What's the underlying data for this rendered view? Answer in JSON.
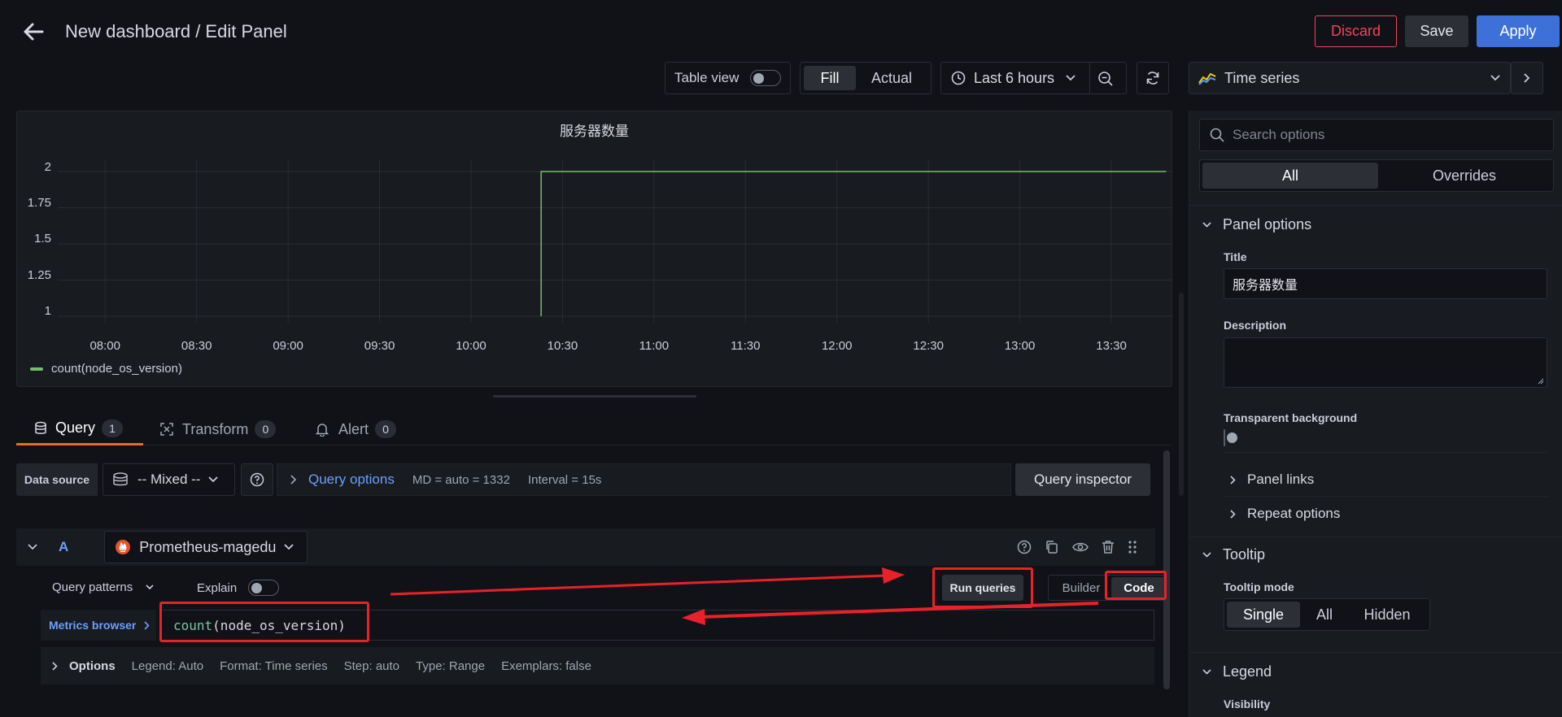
{
  "header": {
    "title": "New dashboard / Edit Panel",
    "discard_label": "Discard",
    "save_label": "Save",
    "apply_label": "Apply"
  },
  "toolbar": {
    "table_view_label": "Table view",
    "fill_label": "Fill",
    "actual_label": "Actual",
    "time_range_label": "Last 6 hours"
  },
  "viz_picker": {
    "label": "Time series"
  },
  "chart_data": {
    "type": "line",
    "title": "服务器数量",
    "x": [
      "10:23",
      "13:48"
    ],
    "series": [
      {
        "name": "count(node_os_version)",
        "color": "#73bf69",
        "values": [
          2,
          2
        ]
      }
    ],
    "x_ticks": [
      "08:00",
      "08:30",
      "09:00",
      "09:30",
      "10:00",
      "10:30",
      "11:00",
      "11:30",
      "12:00",
      "12:30",
      "13:00",
      "13:30"
    ],
    "y_ticks": [
      "2",
      "1.75",
      "1.5",
      "1.25",
      "1"
    ],
    "ylim": [
      1,
      2
    ],
    "grid": true,
    "legend": "bottom-left"
  },
  "query_tabs": [
    {
      "label": "Query",
      "count": "1"
    },
    {
      "label": "Transform",
      "count": "0"
    },
    {
      "label": "Alert",
      "count": "0"
    }
  ],
  "datasource_row": {
    "data_source_label": "Data source",
    "datasource_value": "-- Mixed --",
    "query_options_label": "Query options",
    "md_text": "MD = auto = 1332",
    "interval_text": "Interval = 15s",
    "query_inspector_label": "Query inspector"
  },
  "query_a": {
    "ref_id": "A",
    "datasource": "Prometheus-magedu",
    "query_patterns_label": "Query patterns",
    "explain_label": "Explain",
    "run_queries_label": "Run queries",
    "builder_label": "Builder",
    "code_label": "Code",
    "metrics_browser_label": "Metrics browser",
    "expr_func": "count",
    "expr_rest": "(node_os_version)",
    "options_label": "Options",
    "options_items": [
      "Legend: Auto",
      "Format: Time series",
      "Step: auto",
      "Type: Range",
      "Exemplars: false"
    ]
  },
  "options_pane": {
    "search_placeholder": "Search options",
    "tab_all": "All",
    "tab_overrides": "Overrides",
    "panel_options_label": "Panel options",
    "title_label": "Title",
    "title_value": "服务器数量",
    "description_label": "Description",
    "transparent_label": "Transparent background",
    "panel_links_label": "Panel links",
    "repeat_options_label": "Repeat options",
    "tooltip_label": "Tooltip",
    "tooltip_mode_label": "Tooltip mode",
    "tooltip_modes": [
      "Single",
      "All",
      "Hidden"
    ],
    "legend_label": "Legend",
    "visibility_label": "Visibility"
  },
  "colors": {
    "accent_blue": "#3d71d9",
    "discard_red": "#f5425a",
    "series_green": "#73bf69",
    "link_blue": "#6e9fff",
    "annotation_red": "#e8212b"
  }
}
